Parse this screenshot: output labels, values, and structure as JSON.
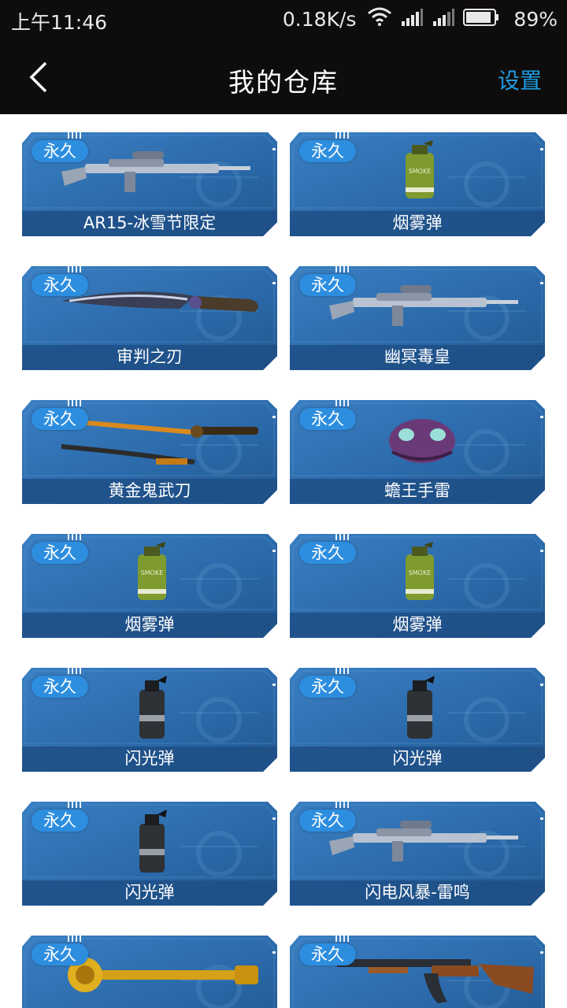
{
  "status_bar": {
    "time": "上午11:46",
    "net_speed": "0.18K/s",
    "battery": "89%",
    "icons": [
      "wifi-icon",
      "signal-icon",
      "signal-icon",
      "battery-icon"
    ]
  },
  "app_bar": {
    "back_icon": "chevron-left-icon",
    "title": "我的仓库",
    "settings_label": "设置",
    "settings_color": "#1e9be0"
  },
  "colors": {
    "card_blue": "#2a68a8",
    "card_label_bar": "#1f4f86",
    "badge": "#2d8ee0"
  },
  "items": [
    {
      "badge": "永久",
      "name": "AR15-冰雪节限定",
      "art": "rifle-icon"
    },
    {
      "badge": "永久",
      "name": "烟雾弹",
      "art": "smoke-grenade-icon"
    },
    {
      "badge": "永久",
      "name": "审判之刃",
      "art": "blade-icon"
    },
    {
      "badge": "永久",
      "name": "幽冥毒皇",
      "art": "rifle-icon"
    },
    {
      "badge": "永久",
      "name": "黄金鬼武刀",
      "art": "katana-icon"
    },
    {
      "badge": "永久",
      "name": "蟾王手雷",
      "art": "toad-grenade-icon"
    },
    {
      "badge": "永久",
      "name": "烟雾弹",
      "art": "smoke-grenade-icon"
    },
    {
      "badge": "永久",
      "name": "烟雾弹",
      "art": "smoke-grenade-icon"
    },
    {
      "badge": "永久",
      "name": "闪光弹",
      "art": "flash-grenade-icon"
    },
    {
      "badge": "永久",
      "name": "闪光弹",
      "art": "flash-grenade-icon"
    },
    {
      "badge": "永久",
      "name": "闪光弹",
      "art": "flash-grenade-icon"
    },
    {
      "badge": "永久",
      "name": "闪电风暴-雷鸣",
      "art": "rifle-icon"
    },
    {
      "badge": "永久",
      "name": "",
      "art": "golden-scepter-icon"
    },
    {
      "badge": "永久",
      "name": "",
      "art": "ak-rifle-icon"
    }
  ]
}
